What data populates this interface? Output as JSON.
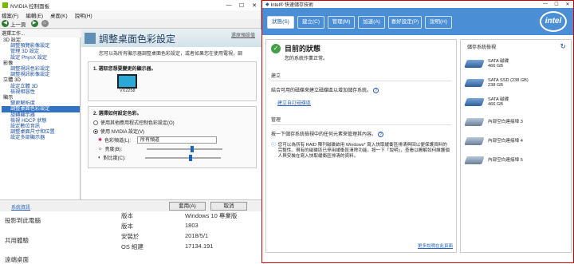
{
  "nvidia": {
    "title": "NVIDIA 控制面板",
    "menu": [
      "檔案(F)",
      "編輯(E)",
      "桌面(K)",
      "說明(H)"
    ],
    "back": "上一頁",
    "tree_title": "選擇工作...",
    "tree": [
      {
        "label": "3D 設定",
        "level": 1
      },
      {
        "label": "調整預覽影像設定",
        "level": 2
      },
      {
        "label": "管理 3D 設定",
        "level": 2
      },
      {
        "label": "設定 PhysX 設定",
        "level": 2
      },
      {
        "label": "影像",
        "level": 1
      },
      {
        "label": "調整視訊色彩設定",
        "level": 2
      },
      {
        "label": "調整視訊影像設定",
        "level": 2
      },
      {
        "label": "立體 3D",
        "level": 1
      },
      {
        "label": "設定立體 3D",
        "level": 2
      },
      {
        "label": "檢視相容性",
        "level": 2
      },
      {
        "label": "顯示",
        "level": 1
      },
      {
        "label": "變更解析度",
        "level": 2
      },
      {
        "label": "調整桌面色彩設定",
        "level": 2,
        "selected": true
      },
      {
        "label": "旋轉顯示器",
        "level": 2
      },
      {
        "label": "檢視 HDCP 狀態",
        "level": 2
      },
      {
        "label": "設定數位音訊",
        "level": 2
      },
      {
        "label": "調整桌面尺寸和位置",
        "level": 2
      },
      {
        "label": "設定多部顯示器",
        "level": 2
      }
    ],
    "page_title": "調整桌面色彩設定",
    "restore": "還原預設值",
    "desc": "您可以為所有顯示器調整桌面色彩設定，或者如果您在使用電視，調",
    "s1_title": "1. 選取您想要變更的顯示器。",
    "monitor_label": "VX2258",
    "s2_title": "2. 選擇如何設定色彩。",
    "opt1": "使用其他應用程式控制色彩設定(O)",
    "opt2": "使用 NVIDIA 設定(V)",
    "channel_label": "色彩頻道(L):",
    "channel_value": "所有頻道",
    "brightness": "亮度(B):",
    "contrast": "對比度(C):",
    "brightness_level": 0.6,
    "contrast_level": 0.6,
    "apply": "套用(A)",
    "cancel": "取消",
    "sysinfo": "系統資訊"
  },
  "settings": {
    "left": [
      "投影到此電腦",
      "共用體驗",
      "遠端桌面"
    ],
    "labels": [
      "版本",
      "版本",
      "安裝於",
      "OS 組建"
    ],
    "values": [
      "Windows 10 專業版",
      "1803",
      "2018/5/1",
      "17134.191"
    ]
  },
  "intel": {
    "title": "Intel® 快速儲存技術",
    "tabs": [
      "狀態(S)",
      "建立(C)",
      "管理(M)",
      "加速(A)",
      "喜好設定(P)",
      "說明(H)"
    ],
    "status_title": "目前的狀態",
    "status_text": "您的系統作業正常。",
    "build_title": "建立",
    "build_text": "結合可用的磁碟來建立磁碟區以增加儲存系統。",
    "build_link": "建立自訂磁碟區",
    "manage_title": "管理",
    "manage_text": "按一下儲存系統檢視中的任何元素來管理其內容。",
    "info": "您可以為所有 RAID 陣列磁碟啟用 Windows* 寫入快取緩衝區排清與回以便保護資料的完整性。現有的磁碟區已停用緩衝區清除功能。按一下「說明」，查看以瞭解如何維護個人與安裝在寫入快取緩衝區排清的資料。",
    "storage_title": "儲存系統檢視",
    "devices": [
      {
        "name": "SATA 磁碟",
        "size": "466 GB"
      },
      {
        "name": "SATA SSD (238 GB)",
        "size": "238 GB"
      },
      {
        "name": "SATA 磁碟",
        "size": "466 GB"
      },
      {
        "name": "內部空白連接埠 3",
        "size": ""
      },
      {
        "name": "內部空白連接埠 4",
        "size": ""
      },
      {
        "name": "內部空白連接埠 5",
        "size": ""
      }
    ],
    "more": "更多說明在此頁面",
    "logo": "intel"
  }
}
